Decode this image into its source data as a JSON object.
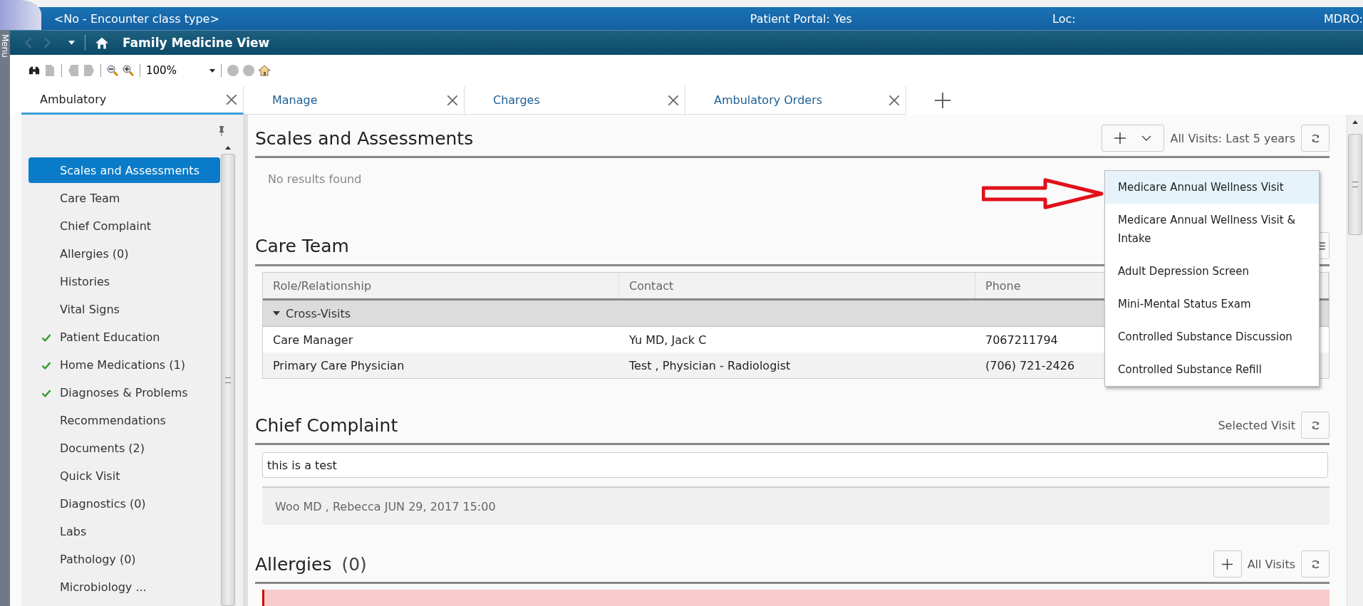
{
  "banner": {
    "encounter": "<No - Encounter class type>",
    "portal": "Patient Portal: Yes",
    "loc": "Loc:",
    "mdro": "MDRO:"
  },
  "side_strip": {
    "label": "Menu"
  },
  "nav": {
    "title": "Family Medicine View"
  },
  "toolbar": {
    "zoom": "100%"
  },
  "tabs": [
    {
      "label": "Ambulatory",
      "selected": true
    },
    {
      "label": "Manage",
      "selected": false
    },
    {
      "label": "Charges",
      "selected": false
    },
    {
      "label": "Ambulatory Orders",
      "selected": false
    }
  ],
  "sidebar": {
    "items": [
      {
        "label": "Scales and Assessments",
        "selected": true,
        "checked": false
      },
      {
        "label": "Care Team",
        "selected": false,
        "checked": false
      },
      {
        "label": "Chief Complaint",
        "selected": false,
        "checked": false
      },
      {
        "label": "Allergies (0)",
        "selected": false,
        "checked": false
      },
      {
        "label": "Histories",
        "selected": false,
        "checked": false
      },
      {
        "label": "Vital Signs",
        "selected": false,
        "checked": false
      },
      {
        "label": "Patient Education",
        "selected": false,
        "checked": true
      },
      {
        "label": "Home Medications (1)",
        "selected": false,
        "checked": true
      },
      {
        "label": "Diagnoses & Problems",
        "selected": false,
        "checked": true
      },
      {
        "label": "Recommendations",
        "selected": false,
        "checked": false
      },
      {
        "label": "Documents (2)",
        "selected": false,
        "checked": false
      },
      {
        "label": "Quick Visit",
        "selected": false,
        "checked": false
      },
      {
        "label": "Diagnostics (0)",
        "selected": false,
        "checked": false
      },
      {
        "label": "Labs",
        "selected": false,
        "checked": false
      },
      {
        "label": "Pathology (0)",
        "selected": false,
        "checked": false
      },
      {
        "label": "Microbiology ...",
        "selected": false,
        "checked": false
      }
    ]
  },
  "scales": {
    "title": "Scales and Assessments",
    "filter": "All Visits: Last 5 years",
    "empty": "No results found"
  },
  "care_team": {
    "title": "Care Team",
    "columns": [
      "Role/Relationship",
      "Contact",
      "Phone"
    ],
    "group": "Cross-Visits",
    "expanded": true,
    "rows": [
      [
        "Care Manager",
        "Yu MD, Jack C",
        "7067211794"
      ],
      [
        "Primary Care Physician",
        "Test , Physician - Radiologist",
        "(706) 721-2426"
      ]
    ]
  },
  "chief_complaint": {
    "title": "Chief Complaint",
    "filter": "Selected Visit",
    "value": "this is a test",
    "author": "Woo MD , Rebecca JUN 29, 2017 15:00"
  },
  "allergies": {
    "title": "Allergies",
    "count": "(0)",
    "filter": "All Visits"
  },
  "dropdown": {
    "items": [
      {
        "label": "Medicare Annual Wellness Visit",
        "selected": true
      },
      {
        "label": "Medicare Annual Wellness Visit & Intake",
        "selected": false
      },
      {
        "label": "Adult Depression Screen",
        "selected": false
      },
      {
        "label": "Mini-Mental Status Exam",
        "selected": false
      },
      {
        "label": "Controlled Substance Discussion",
        "selected": false
      },
      {
        "label": "Controlled Substance Refill",
        "selected": false
      }
    ]
  }
}
